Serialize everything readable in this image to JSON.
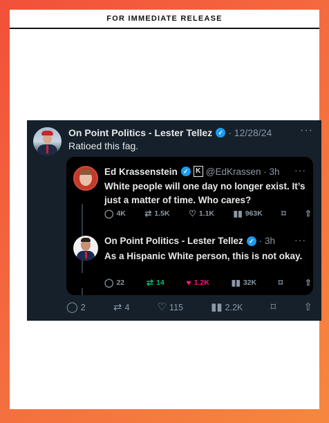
{
  "header": {
    "title": "FOR IMMEDIATE RELEASE"
  },
  "post": {
    "author": "On Point Politics - Lester Tellez",
    "date": "· 12/28/24",
    "more": "···",
    "text": "Ratioed this fag.",
    "quoted": {
      "first": {
        "author": "Ed Krassenstein",
        "badge": "K",
        "handle": "@EdKrassen · 3h",
        "text": "White people will one day no longer exist. It’s just a matter of time. Who cares?",
        "replies": "4K",
        "reposts": "1.5K",
        "likes": "1.1K",
        "views": "963K"
      },
      "second": {
        "author": "On Point Politics - Lester Tellez",
        "time": "· 3h",
        "text": "As a Hispanic White person, this is not okay.",
        "replies": "22",
        "reposts": "14",
        "likes": "1.2K",
        "views": "32K"
      }
    },
    "stats": {
      "replies": "2",
      "reposts": "4",
      "likes": "115",
      "views": "2.2K"
    }
  },
  "colors": {
    "background": "#f46a3f",
    "tweet_bg": "#15202b",
    "verified": "#1d9bf0",
    "repost_active": "#00ba7c",
    "like_active": "#f91880"
  }
}
